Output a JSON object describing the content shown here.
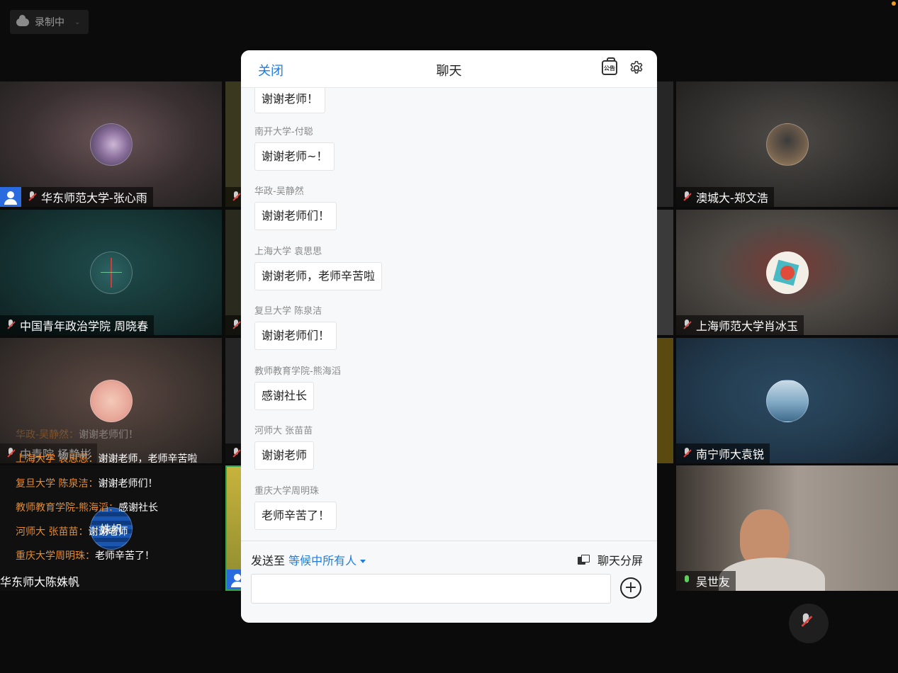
{
  "recording": {
    "label": "录制中"
  },
  "tiles": {
    "t1": {
      "name": "华东师范大学-张心雨"
    },
    "t2": {
      "name": "澳城大-郑文浩"
    },
    "t3": {
      "name": "中国青年政治学院 周晓春"
    },
    "t4": {
      "name": "上海师范大学肖冰玉"
    },
    "t5": {
      "name": "中青院 杨静彬"
    },
    "t6": {
      "name": "南宁师大袁锐"
    },
    "t7": {
      "name": "华东师大陈姝帆"
    },
    "t8": {
      "name": "吴世友"
    },
    "t7_avatar_text": "姝帆"
  },
  "danmaku": [
    {
      "who": "华政-吴静然：",
      "msg": "谢谢老师们！"
    },
    {
      "who": "上海大学 袁思思：",
      "msg": "谢谢老师，老师辛苦啦"
    },
    {
      "who": "复旦大学 陈泉洁：",
      "msg": "谢谢老师们！"
    },
    {
      "who": "教师教育学院-熊海滔：",
      "msg": "感谢社长"
    },
    {
      "who": "河师大 张苗苗：",
      "msg": "谢谢老师"
    },
    {
      "who": "重庆大学周明珠：",
      "msg": "老师辛苦了！"
    }
  ],
  "chat": {
    "close_label": "关闭",
    "title": "聊天",
    "announcement_label": "公告",
    "messages": [
      {
        "sender": "",
        "text": "谢谢老师！"
      },
      {
        "sender": "南开大学-付聪",
        "text": "谢谢老师~！"
      },
      {
        "sender": "华政-吴静然",
        "text": "谢谢老师们！"
      },
      {
        "sender": "上海大学 袁思思",
        "text": "谢谢老师，老师辛苦啦"
      },
      {
        "sender": "复旦大学 陈泉洁",
        "text": "谢谢老师们！"
      },
      {
        "sender": "教师教育学院-熊海滔",
        "text": "感谢社长"
      },
      {
        "sender": "河师大 张苗苗",
        "text": "谢谢老师"
      },
      {
        "sender": "重庆大学周明珠",
        "text": "老师辛苦了！"
      }
    ],
    "send_to_label": "发送至",
    "send_target": "等候中所有人",
    "split_label": "聊天分屏",
    "input_placeholder": ""
  },
  "colors": {
    "accent": "#1e7de1",
    "danmaku_name": "#e88a2c"
  },
  "icons": [
    "cloud-icon",
    "mic-muted-icon",
    "mic-icon",
    "person-icon",
    "announcement-icon",
    "gear-icon",
    "split-screen-icon",
    "plus-icon"
  ]
}
